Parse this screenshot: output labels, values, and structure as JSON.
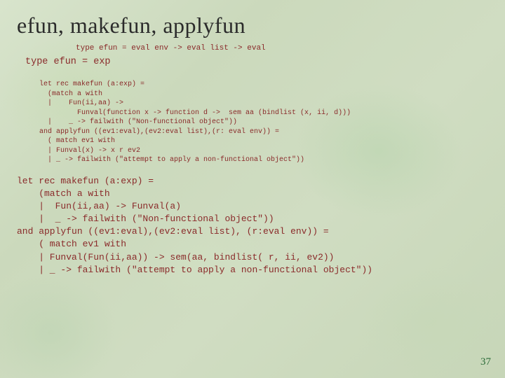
{
  "title": "efun, makefun, applyfun",
  "type_sig_old": "type efun = eval env -> eval list -> eval",
  "type_sig_new": "type efun = exp",
  "code_block1": "let rec makefun (a:exp) =\n  (match a with\n  |    Fun(ii,aa) ->\n         Funval(function x -> function d ->  sem aa (bindlist (x, ii, d)))\n  |    _ -> failwith (\"Non-functional object\"))\nand applyfun ((ev1:eval),(ev2:eval list),(r: eval env)) =\n  ( match ev1 with\n  | Funval(x) -> x r ev2\n  | _ -> failwith (\"attempt to apply a non-functional object\"))",
  "code_block2": "let rec makefun (a:exp) =\n    (match a with\n    |  Fun(ii,aa) -> Funval(a)\n    |  _ -> failwith (\"Non-functional object\"))\nand applyfun ((ev1:eval),(ev2:eval list), (r:eval env)) =\n    ( match ev1 with\n    | Funval(Fun(ii,aa)) -> sem(aa, bindlist( r, ii, ev2))\n    | _ -> failwith (\"attempt to apply a non-functional object\"))",
  "page_number": "37"
}
